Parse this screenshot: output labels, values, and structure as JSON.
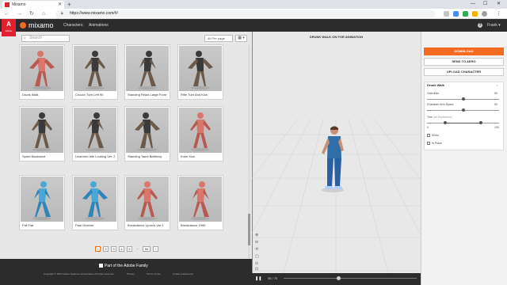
{
  "browser": {
    "tab_title": "Mixamo",
    "url": "https://www.mixamo.com/#/",
    "win_min": "—",
    "win_max": "☐",
    "win_close": "✕",
    "new_tab": "+"
  },
  "header": {
    "logo": "mixamo",
    "adobe_label": "Adobe",
    "nav": [
      "Characters",
      "Animations"
    ],
    "help": "?",
    "user": "Frank ▾"
  },
  "library": {
    "search_placeholder": "Search",
    "per_page": "48 Per page",
    "grid_icon": "▦ ▾",
    "cards": [
      {
        "name": "Drunk Walk",
        "figure": "mannequin"
      },
      {
        "name": "Crouch Turn Left 90",
        "figure": "dark"
      },
      {
        "name": "Standing React Large From",
        "figure": "dark"
      },
      {
        "name": "Rifle Turn And Kick",
        "figure": "dark"
      },
      {
        "name": "Sprint Backward",
        "figure": "dark"
      },
      {
        "name": "Unarmed Idle Looking Ver. 2",
        "figure": "dark"
      },
      {
        "name": "Standing Taunt Battlecry",
        "figure": "dark"
      },
      {
        "name": "Knee Kick",
        "figure": "mannequin"
      },
      {
        "name": "Fall Flat",
        "figure": "blue"
      },
      {
        "name": "Pain Gesture",
        "figure": "blue"
      },
      {
        "name": "Breakdance Uprock Var 2",
        "figure": "mannequin"
      },
      {
        "name": "Breakdance 1990",
        "figure": "mannequin"
      }
    ],
    "pages": [
      "1",
      "2",
      "3",
      "4",
      "5",
      "...",
      "50",
      "›"
    ],
    "current_page": "1"
  },
  "footer": {
    "family": "Part of the Adobe Family",
    "copyright": "Copyright © 2021 Adobe Systems Incorporated. All rights reserved.",
    "links": [
      "Privacy",
      "Terms of Use",
      "Cookie preferences"
    ]
  },
  "viewer": {
    "title": "DRUNK WALK ON FOR ANIMATION",
    "frame_counter": "36 / 70",
    "play_icon": "❚❚",
    "progress": 0.41,
    "tools": [
      "⊕",
      "⊖",
      "⟲",
      "▢",
      "⊙",
      "⊡"
    ]
  },
  "panel": {
    "download": "DOWNLOAD",
    "send": "SEND TO AERO",
    "upload": "UPLOAD CHARACTER",
    "animation_name": "Drunk Walk",
    "collapse_icon": "›",
    "sliders": [
      {
        "label": "Overdrive",
        "value": "50",
        "fraction": 0.5
      },
      {
        "label": "Character Arm-Space",
        "value": "50",
        "fraction": 0.5
      }
    ],
    "trim_label": "Trim",
    "trim_sub": "(All Keyframes)",
    "trim_min": "0",
    "trim_max": "100",
    "trim_range": [
      0.25,
      0.75
    ],
    "checkboxes": [
      "Mirror",
      "In Place"
    ]
  },
  "colors": {
    "accent": "#f26b21",
    "adobe_red": "#e0202e",
    "dark": "#2c2c2c"
  }
}
